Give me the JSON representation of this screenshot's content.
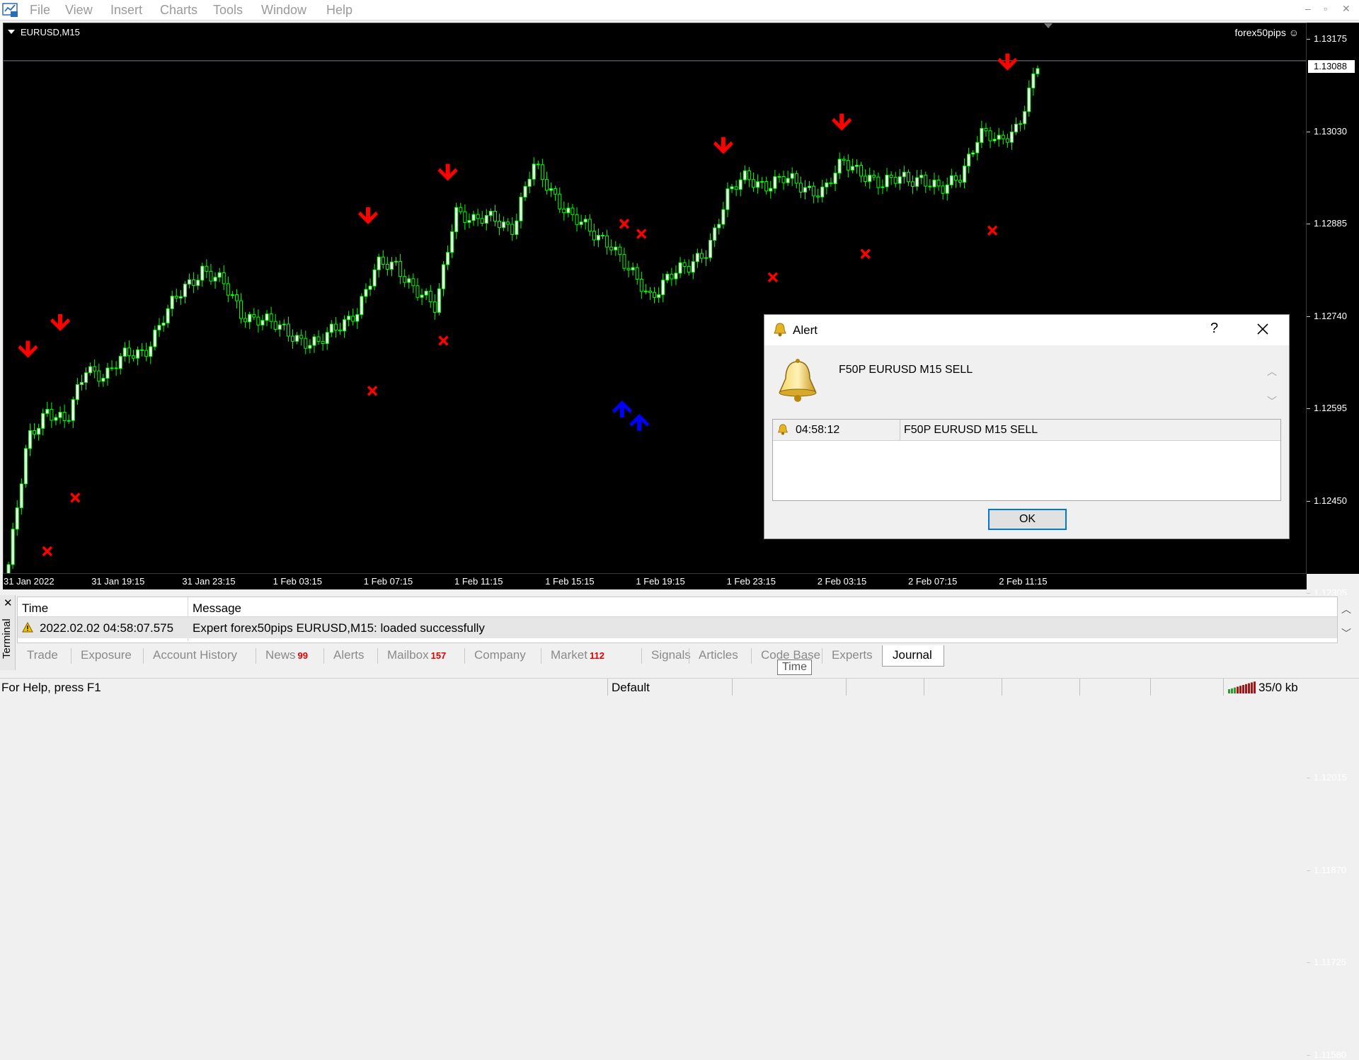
{
  "menu": {
    "items": [
      "File",
      "View",
      "Insert",
      "Charts",
      "Tools",
      "Window",
      "Help"
    ]
  },
  "window_controls": {
    "minimize": "–",
    "restore": "▫",
    "close": "✕"
  },
  "chart": {
    "symbol": "EURUSD,M15",
    "expert": "forex50pips ☺",
    "current_price": "1.13088",
    "price_ticks": [
      "1.13175",
      "1.13030",
      "1.12885",
      "1.12740",
      "1.12595",
      "1.12450",
      "1.12305",
      "1.12160",
      "1.12015",
      "1.11870",
      "1.11725",
      "1.11580"
    ],
    "time_ticks": [
      "31 Jan 2022",
      "31 Jan 19:15",
      "31 Jan 23:15",
      "1 Feb 03:15",
      "1 Feb 07:15",
      "1 Feb 11:15",
      "1 Feb 15:15",
      "1 Feb 19:15",
      "1 Feb 23:15",
      "2 Feb 03:15",
      "2 Feb 07:15",
      "2 Feb 11:15"
    ],
    "colors": {
      "background": "#000000",
      "candle": "#00ff00",
      "sell_arrow": "#ff0000",
      "buy_arrow": "#0000ff",
      "cross": "#ff0000",
      "price_line": "#708090"
    }
  },
  "chart_data": {
    "type": "candlestick",
    "series": [
      {
        "name": "EURUSD,M15",
        "close_path": [
          1.1158,
          1.1195,
          1.1205,
          1.12,
          1.1217,
          1.1215,
          1.122,
          1.1222,
          1.1232,
          1.124,
          1.1247,
          1.1242,
          1.1233,
          1.1232,
          1.1228,
          1.1226,
          1.1224,
          1.1229,
          1.1235,
          1.1247,
          1.1248,
          1.124,
          1.1234,
          1.1265,
          1.126,
          1.1262,
          1.1259,
          1.1277,
          1.127,
          1.1262,
          1.1257,
          1.1255,
          1.1245,
          1.1238,
          1.1245,
          1.1246,
          1.1253,
          1.1268,
          1.1274,
          1.1272,
          1.1273,
          1.1271,
          1.127,
          1.1278,
          1.1276,
          1.1271,
          1.1274,
          1.1274,
          1.1269,
          1.1275,
          1.1287,
          1.1284,
          1.129,
          1.1307
        ]
      }
    ],
    "sell_signals": [
      "31 Jan 2022",
      "31 Jan 2022",
      "31 Jan 23:15+",
      "1 Feb 07:15+",
      "1 Feb 19:15+",
      "1 Feb 23:15+",
      "2 Feb 07:15+"
    ],
    "buy_signals": [
      "1 Feb 15:15+",
      "1 Feb 15:15+"
    ],
    "ylim": [
      1.1155,
      1.132
    ]
  },
  "alert": {
    "title": "Alert",
    "help": "?",
    "message": "F50P EURUSD  M15 SELL",
    "rows": [
      {
        "time": "04:58:12",
        "message": "F50P EURUSD  M15 SELL"
      }
    ],
    "ok_label": "OK"
  },
  "terminal": {
    "close": "✕",
    "vertical_label": "Terminal",
    "columns": [
      "Time",
      "Message"
    ],
    "rows": [
      {
        "time": "2022.02.02 04:58:07.575",
        "message": "Expert forex50pips EURUSD,M15: loaded successfully"
      }
    ],
    "tabs": [
      {
        "label": "Trade",
        "badge": ""
      },
      {
        "label": "Exposure",
        "badge": ""
      },
      {
        "label": "Account History",
        "badge": ""
      },
      {
        "label": "News",
        "badge": "99"
      },
      {
        "label": "Alerts",
        "badge": ""
      },
      {
        "label": "Mailbox",
        "badge": "157"
      },
      {
        "label": "Company",
        "badge": ""
      },
      {
        "label": "Market",
        "badge": "112"
      },
      {
        "label": "Signals",
        "badge": ""
      },
      {
        "label": "Articles",
        "badge": ""
      },
      {
        "label": "Code Base",
        "badge": ""
      },
      {
        "label": "Experts",
        "badge": ""
      },
      {
        "label": "Journal",
        "badge": ""
      }
    ],
    "tooltip": "Time"
  },
  "status": {
    "help": "For Help, press F1",
    "profile": "Default",
    "traffic": "35/0 kb"
  }
}
